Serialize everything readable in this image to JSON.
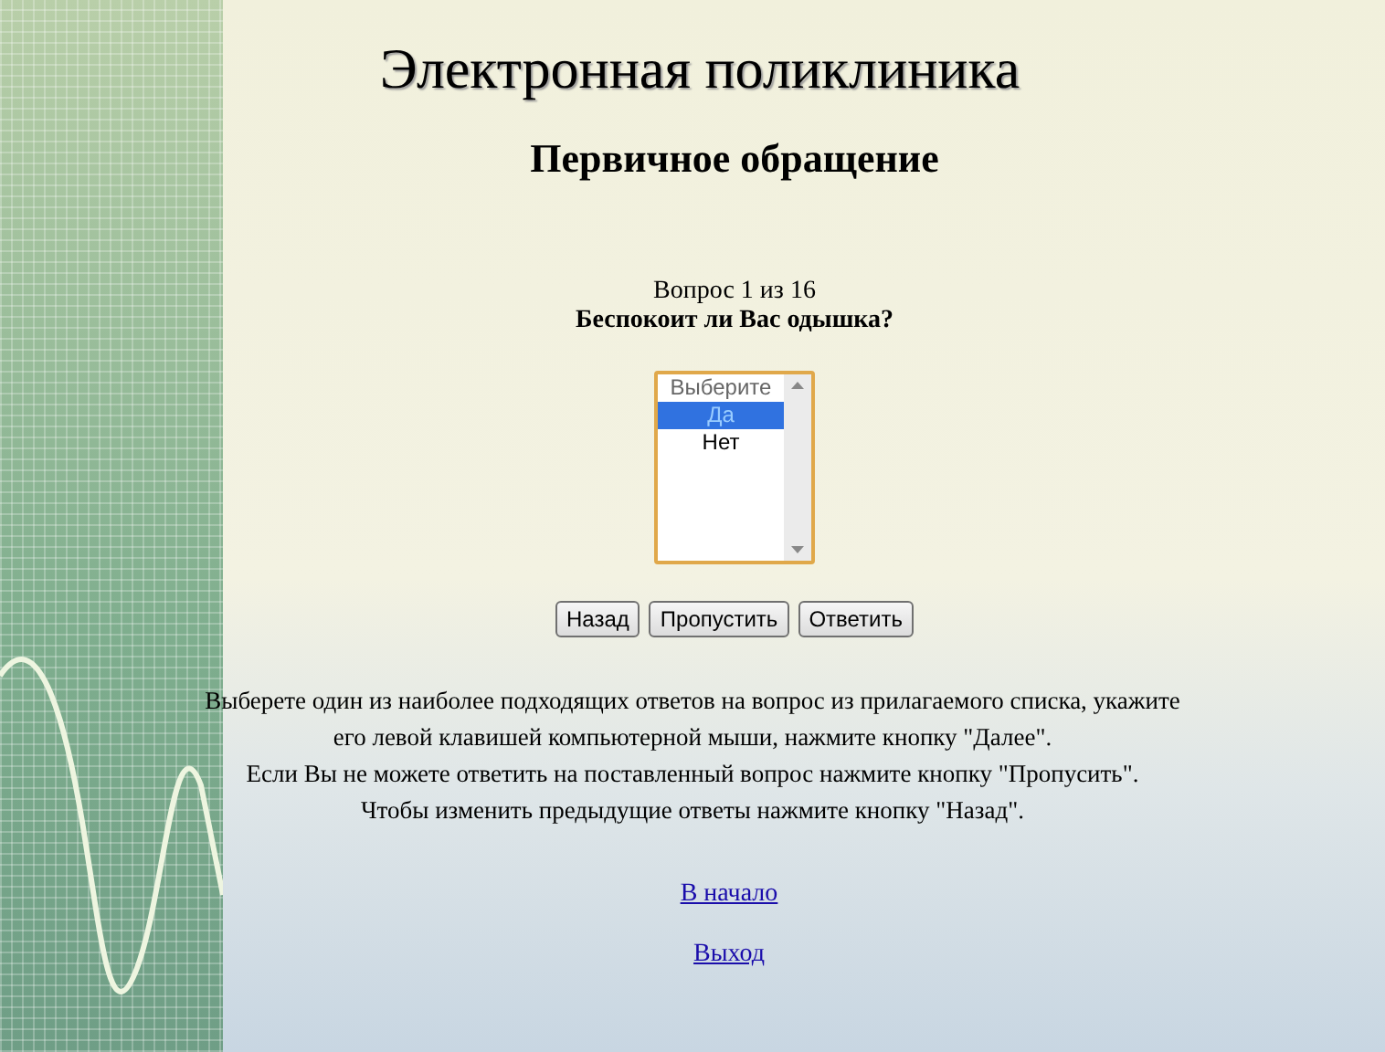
{
  "title": "Электронная поликлиника",
  "subtitle": "Первичное обращение",
  "question_counter": "Вопрос 1 из 16",
  "question": "Беспокоит ли Вас одышка?",
  "answer_list": {
    "options": [
      {
        "label": "Выберите",
        "selected": false,
        "disabled": true
      },
      {
        "label": "Да",
        "selected": true,
        "disabled": false
      },
      {
        "label": "Нет",
        "selected": false,
        "disabled": false
      }
    ]
  },
  "buttons": [
    "Назад",
    "Пропустить",
    "Ответить"
  ],
  "instructions": [
    "Выберете один из наиболее подходящих ответов на вопрос из прилагаемого списка, укажите",
    "его левой клавишей компьютерной мыши, нажмите кнопку \"Далее\".",
    "Если Вы не можете ответить на поставленный вопрос нажмите кнопку \"Пропусить\".",
    "Чтобы изменить предыдущие ответы нажмите кнопку \"Назад\"."
  ],
  "links": [
    "В начало",
    "Выход"
  ]
}
